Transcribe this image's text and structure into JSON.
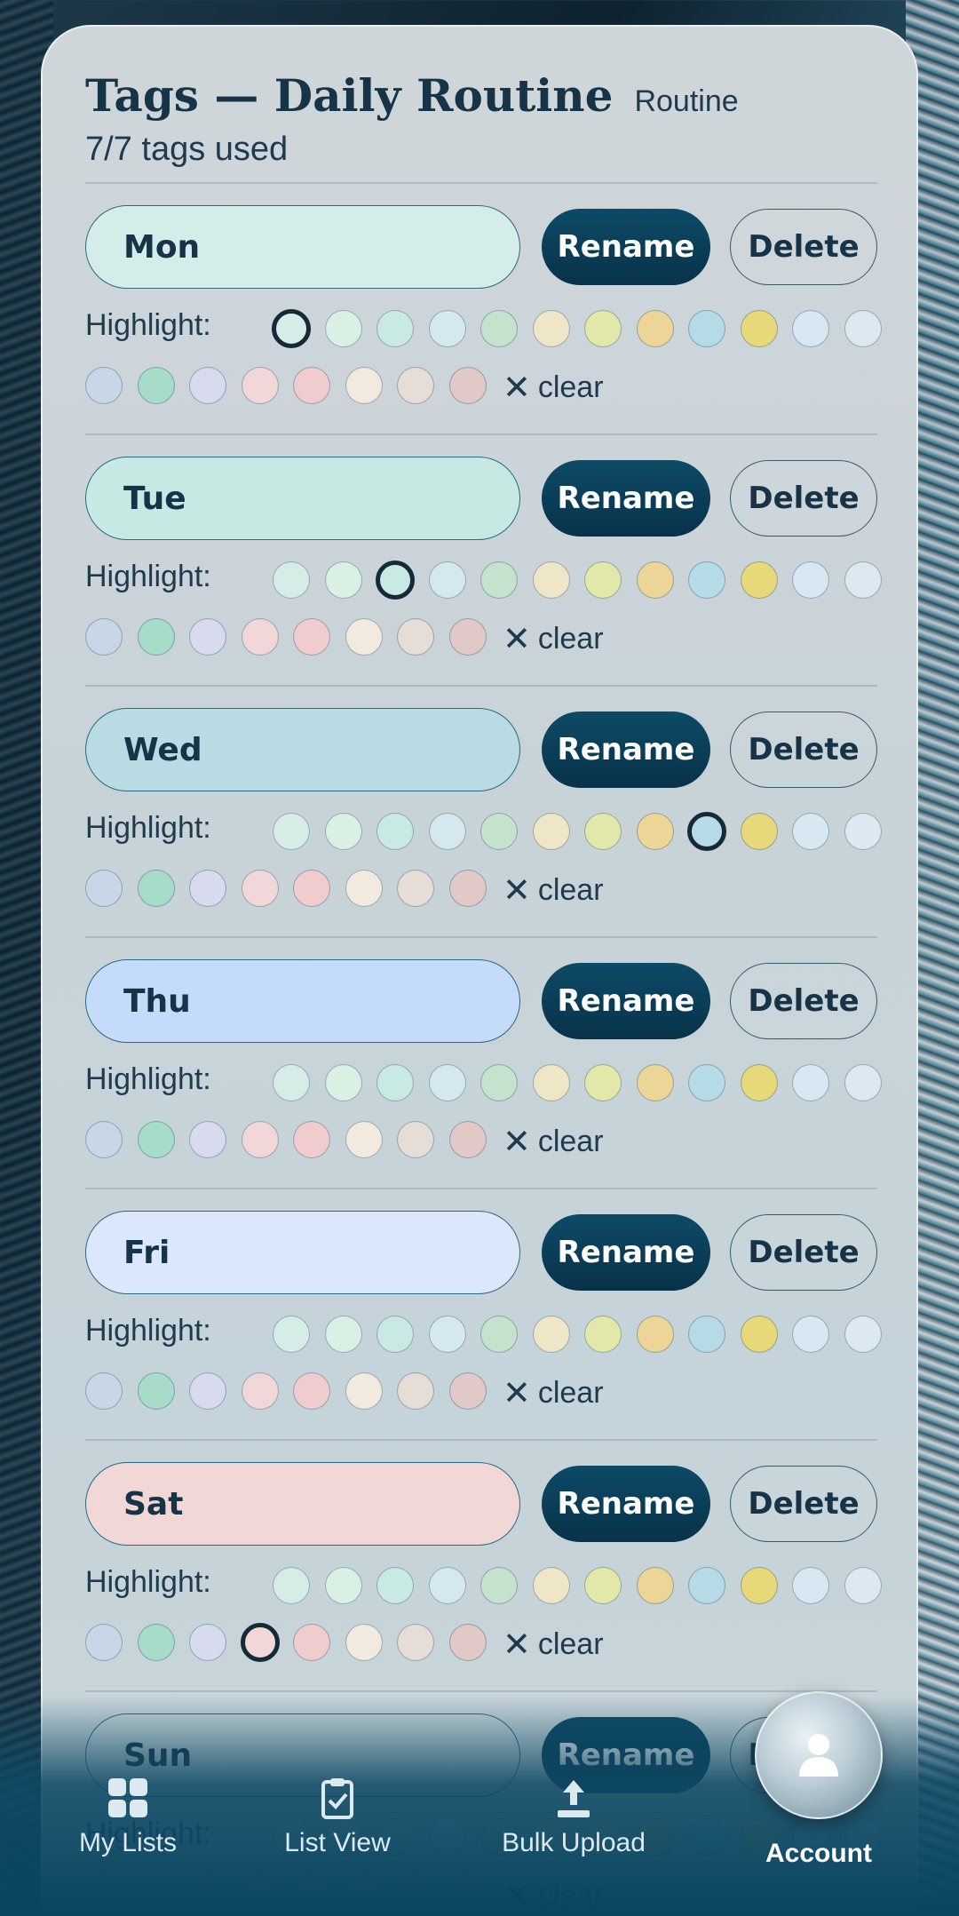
{
  "header": {
    "title": "Tags — Daily Routine",
    "subtitle": "Routine",
    "count": "7/7 tags used"
  },
  "labels": {
    "rename": "Rename",
    "delete": "Delete",
    "highlight": "Highlight:",
    "clear": "clear",
    "clear_glyph": "✕"
  },
  "palette": [
    "#d6ece6",
    "#daf0e4",
    "#c8eae2",
    "#d5e8ee",
    "#c4e2cc",
    "#efe6c8",
    "#e2e8aa",
    "#ecd596",
    "#b6dbe6",
    "#e7d87a",
    "#d8e8f2",
    "#dde9f1",
    "#c8d7e8",
    "#a7dcc8",
    "#d8daee",
    "#f2d7d8",
    "#f0cccf",
    "#f2e9df",
    "#e6ddd6",
    "#e0c9c6"
  ],
  "tags": [
    {
      "name": "Mon",
      "fill": "#d4ede8",
      "selected": 0
    },
    {
      "name": "Tue",
      "fill": "#c6e9e4",
      "selected": 2
    },
    {
      "name": "Wed",
      "fill": "#b8dbe4",
      "selected": 8
    },
    {
      "name": "Thu",
      "fill": "#c4dcfa",
      "selected": -1
    },
    {
      "name": "Fri",
      "fill": "#dbe8fb",
      "selected": -1
    },
    {
      "name": "Sat",
      "fill": "#f1d8d7",
      "selected": 15
    },
    {
      "name": "Sun",
      "fill": "#c9d6da",
      "selected": -1
    }
  ],
  "nav": {
    "items": [
      {
        "label": "My Lists",
        "icon": "grid-icon"
      },
      {
        "label": "List View",
        "icon": "clipboard-check-icon"
      },
      {
        "label": "Bulk Upload",
        "icon": "upload-icon"
      },
      {
        "label": "Account",
        "icon": "user-icon"
      }
    ],
    "active": "Account"
  }
}
